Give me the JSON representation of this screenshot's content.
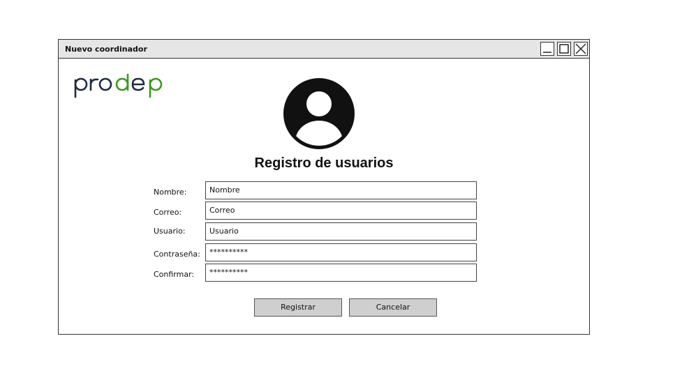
{
  "window": {
    "title": "Nuevo coordinador",
    "controls": [
      "minimize-icon",
      "maximize-icon",
      "close-icon"
    ]
  },
  "logo": {
    "text": "prodep",
    "colors": {
      "primary": "#1f2a44",
      "accent": "#3a9a1a"
    }
  },
  "avatar": {
    "icon": "user-avatar-icon",
    "color": "#111111"
  },
  "heading": "Registro de usuarios",
  "form": {
    "fields": [
      {
        "label": "Nombre:",
        "value": "Nombre"
      },
      {
        "label": "Correo:",
        "value": "Correo"
      },
      {
        "label": "Usuario:",
        "value": "Usuario"
      },
      {
        "label": "Contraseña:",
        "value": "**********"
      },
      {
        "label": "Confirmar:",
        "value": "**********"
      }
    ]
  },
  "actions": {
    "register_label": "Registrar",
    "cancel_label": "Cancelar"
  }
}
